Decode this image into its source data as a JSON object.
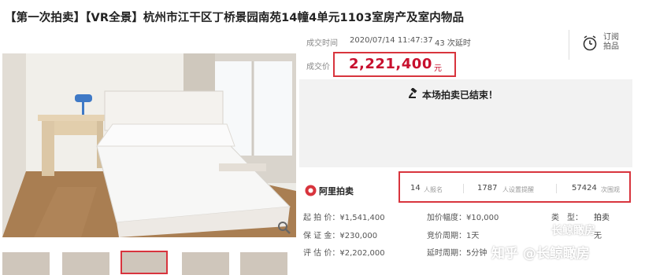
{
  "title": "【第一次拍卖】【VR全景】杭州市江干区丁桥景园南苑14幢4单元1103室房产及室内物品",
  "deal": {
    "time_label": "成交时间",
    "time_value": "2020/07/14 11:47:37",
    "delays": "43 次延时",
    "price_label": "成交价",
    "price": "2,221,400",
    "price_unit": "元"
  },
  "subscribe_label": "订阅拍品",
  "ended_text": "本场拍卖已结束！",
  "logo_text": "阿里拍卖",
  "stats": {
    "signups": "14",
    "signups_label": "人报名",
    "reminders": "1787",
    "reminders_label": "人设置提醒",
    "views": "57424",
    "views_label": "次围观"
  },
  "details": {
    "start_price": "起 拍 价：¥1,541,400",
    "deposit": "保 证 金：¥230,000",
    "appraisal": "评 估 价：¥2,202,000",
    "increment": "加价幅度：¥10,000",
    "bid_cycle": "竞价周期：1天",
    "delay_cycle": "延时周期：5分钟",
    "type_label": "类　型：",
    "type_value": "拍卖",
    "limit_suffix": "无"
  },
  "watermark": {
    "top": "长鲸瞰房",
    "bottom": "知乎 @长鲸瞰房"
  },
  "colors": {
    "highlight_red": "#d8343d",
    "price_red": "#c8102e",
    "ended_bg": "#f2f2f2"
  },
  "icons": [
    "clock-icon",
    "gavel-icon",
    "magnifier-icon",
    "ali-logo-icon"
  ]
}
